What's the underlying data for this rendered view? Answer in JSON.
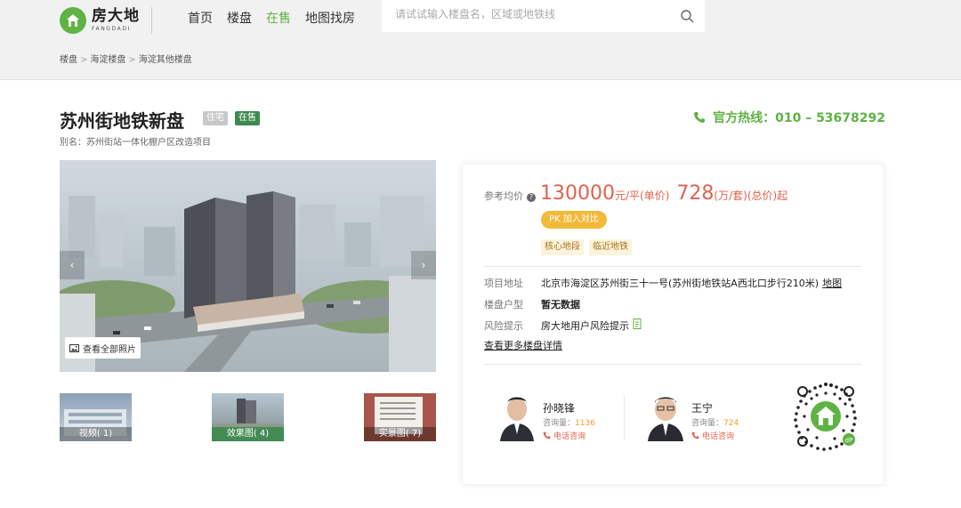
{
  "header": {
    "logo_cn": "房大地",
    "logo_en": "FANGDADI",
    "nav": [
      {
        "label": "首页",
        "active": false
      },
      {
        "label": "楼盘",
        "active": false
      },
      {
        "label": "在售",
        "active": true
      },
      {
        "label": "地图找房",
        "active": false
      }
    ],
    "search_placeholder": "请试试输入楼盘名，区域或地铁线"
  },
  "breadcrumb": [
    "楼盘",
    "海淀楼盘",
    "海淀其他楼盘"
  ],
  "property": {
    "title": "苏州街地铁新盘",
    "type_badge": "住宅",
    "status_badge": "在售",
    "alias": "别名：苏州街站一体化棚户区改造项目"
  },
  "hotline": {
    "label": "官方热线：010 – 53678292"
  },
  "gallery": {
    "all_photos_label": "查看全部照片",
    "thumbs": [
      {
        "label": "视频( 1)"
      },
      {
        "label": "效果图( 4)"
      },
      {
        "label": "实景图( 7)"
      }
    ]
  },
  "card": {
    "price_label": "参考均价",
    "unit_price": "130000",
    "unit_price_suffix": "元/平(单价)",
    "total_price": "728",
    "total_price_suffix": "(万/套)(总价)起",
    "pk_label": "PK  加入对比",
    "tags": [
      "核心地段",
      "临近地铁"
    ],
    "address_key": "项目地址",
    "address_value": "北京市海淀区苏州街三十一号(苏州街地铁站A西北口步行210米)",
    "map_link": "地图",
    "layout_key": "楼盘户型",
    "layout_value": "暂无数据",
    "risk_key": "风险提示",
    "risk_value": "房大地用户风险提示",
    "more_link": "查看更多楼盘详情",
    "agents": [
      {
        "name": "孙晓锋",
        "count_label": "咨询量：",
        "count": "1136",
        "call": "电话咨询"
      },
      {
        "name": "王宁",
        "count_label": "咨询量：",
        "count": "724",
        "call": "电话咨询"
      }
    ]
  },
  "colors": {
    "brand_green": "#5fb244",
    "price_red": "#e0624f",
    "pk_yellow": "#f3b93a"
  }
}
